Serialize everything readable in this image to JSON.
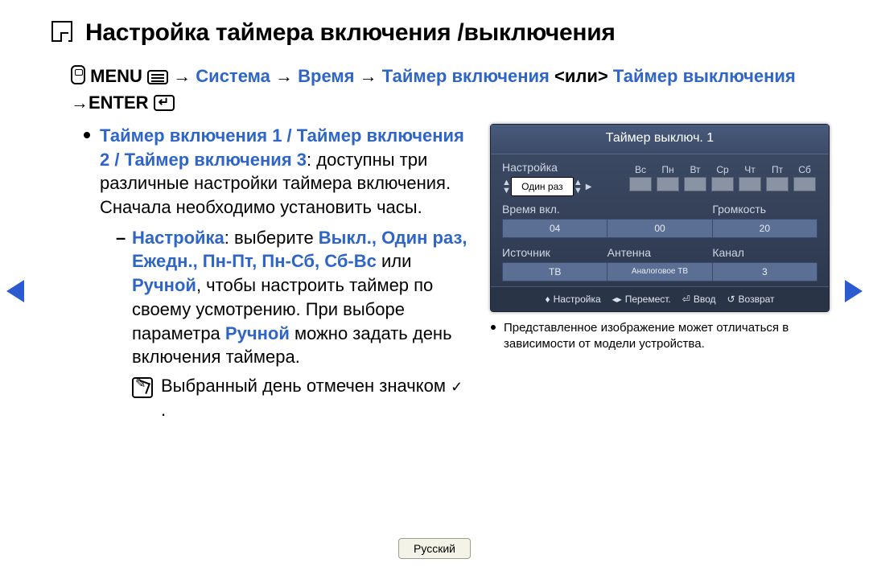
{
  "title": "Настройка таймера включения /выключения",
  "breadcrumb": {
    "menu": "MENU",
    "arrow": "→",
    "p1": "Система",
    "p2": "Время",
    "p3": "Таймер включения",
    "or_prefix": "<или>",
    "p4": "Таймер выключения",
    "enter": "ENTER"
  },
  "body": {
    "bullet1_head": "Таймер включения 1 / Таймер включения 2 / Таймер включения 3",
    "bullet1_rest": ": доступны три различные настройки таймера включения. Сначала необходимо установить часы.",
    "bullet2_label": "Настройка",
    "bullet2_text1": ": выберите ",
    "bullet2_opts": "Выкл., Один раз, Ежедн., Пн-Пт, Пн-Сб, Сб-Вс",
    "bullet2_or": " или ",
    "bullet2_manual": "Ручной",
    "bullet2_text2": ", чтобы настроить таймер по своему усмотрению. При выборе параметра ",
    "bullet2_manual2": "Ручной",
    "bullet2_text3": " можно задать день включения таймера.",
    "note_text": "Выбранный день отмечен значком ",
    "note_check": "✓",
    "note_dot": "."
  },
  "osd": {
    "title": "Таймер выключ. 1",
    "setup_label": "Настройка",
    "setup_value": "Один раз",
    "days": [
      "Вс",
      "Пн",
      "Вт",
      "Ср",
      "Чт",
      "Пт",
      "Сб"
    ],
    "time_on_label": "Время вкл.",
    "volume_label": "Громкость",
    "time_h": "04",
    "time_m": "00",
    "volume": "20",
    "source_label": "Источник",
    "antenna_label": "Антенна",
    "channel_label": "Канал",
    "source_value": "ТВ",
    "antenna_value": "Аналоговое ТВ",
    "channel_value": "3",
    "footer": {
      "f1": "Настройка",
      "f2": "Перемест.",
      "f3": "Ввод",
      "f4": "Возврат"
    }
  },
  "caption": "Представленное изображение может отличаться в зависимости от модели устройства.",
  "language": "Русский"
}
